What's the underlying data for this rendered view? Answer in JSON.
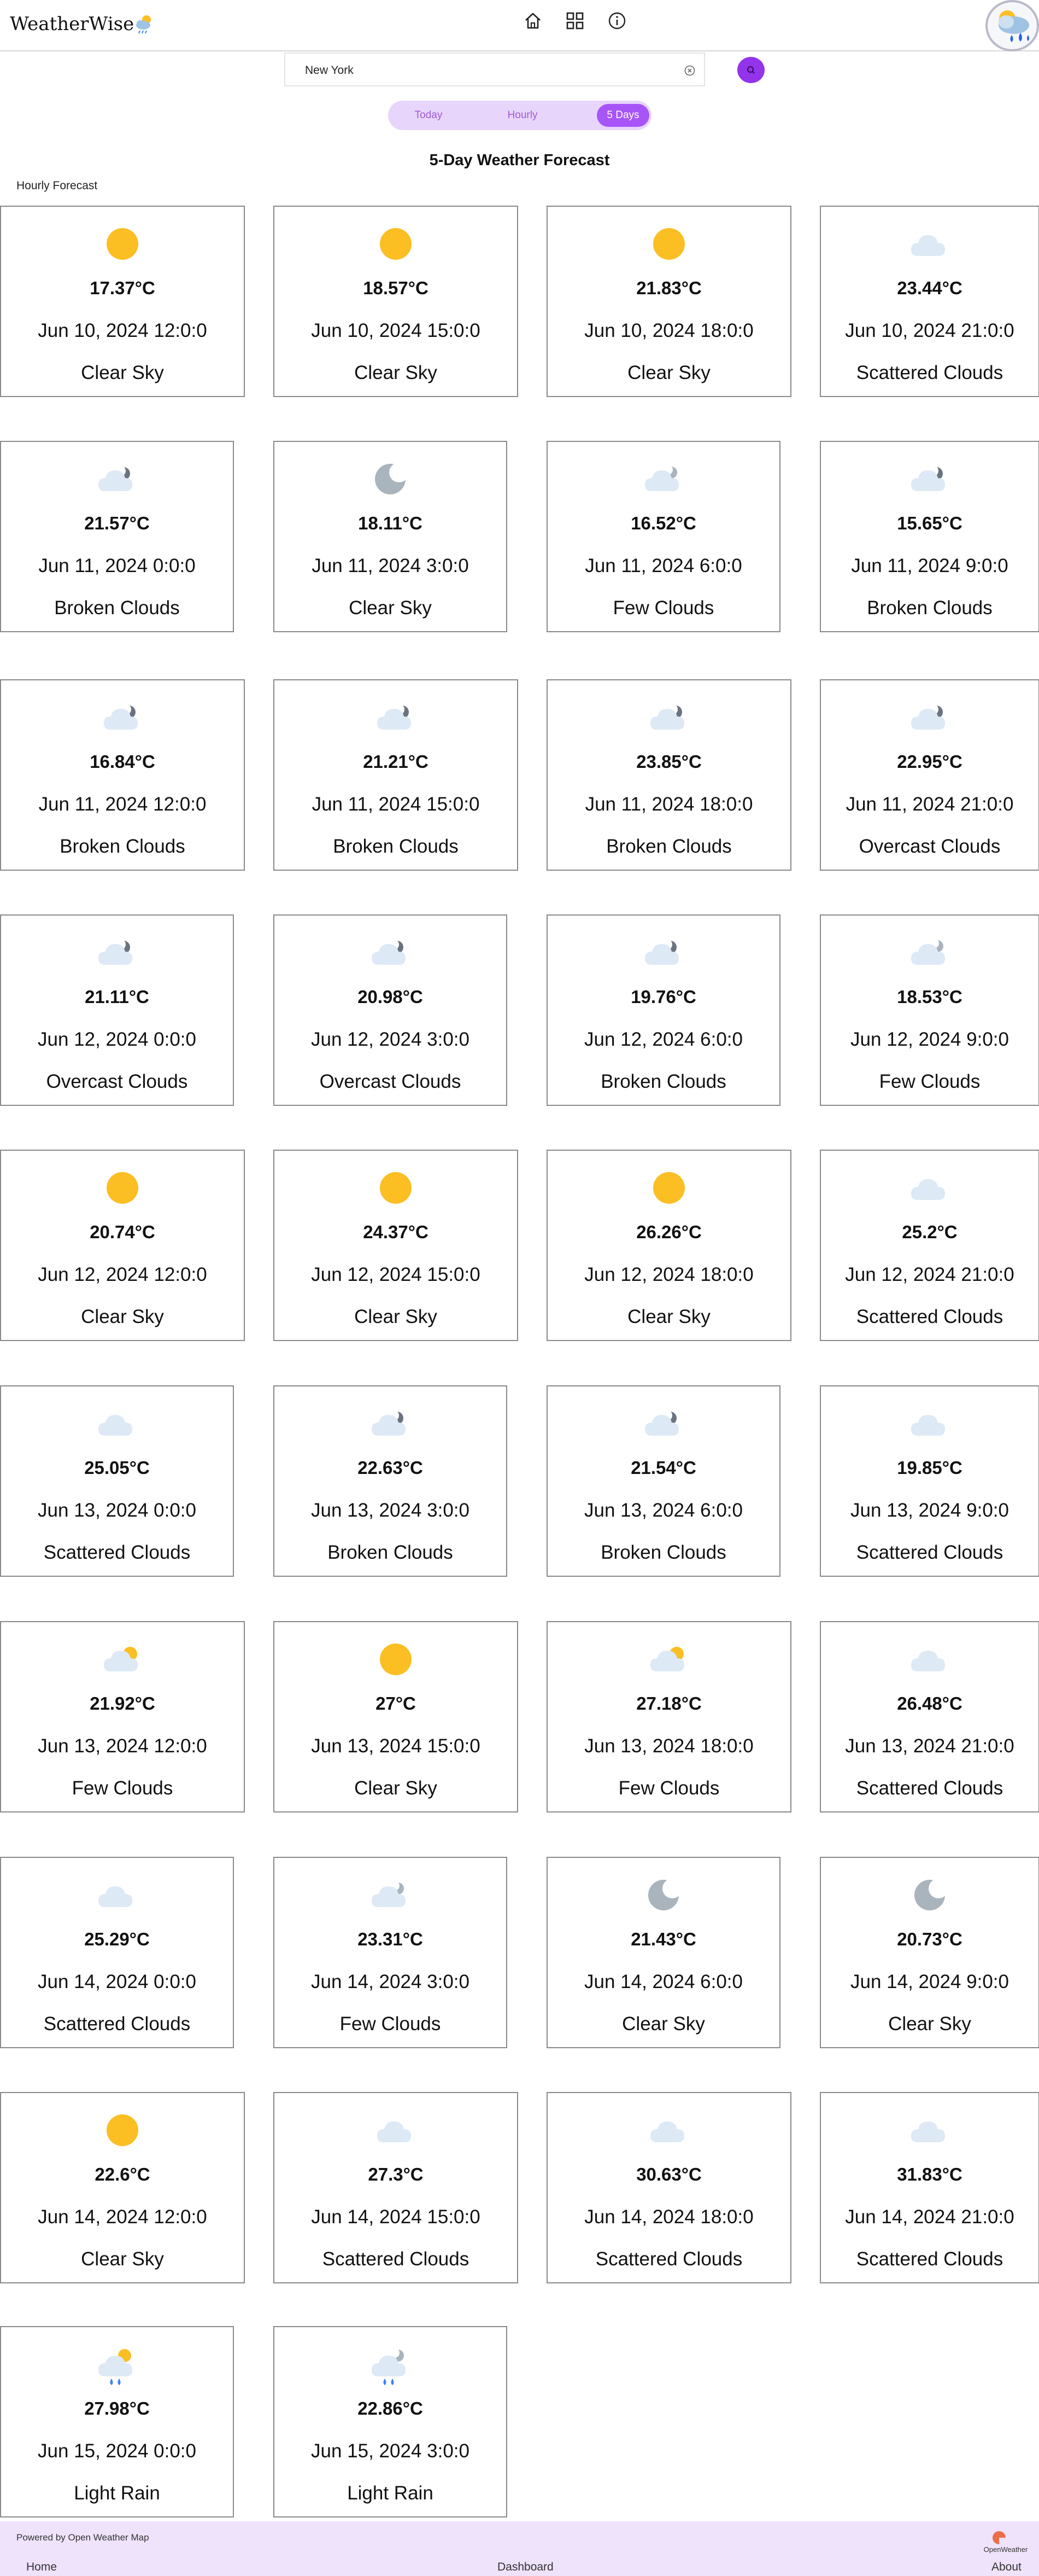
{
  "app": {
    "title": "WeatherWise",
    "nav": {
      "home_icon": "home-icon",
      "dashboard_icon": "grid-icon",
      "about_icon": "info-icon"
    }
  },
  "search": {
    "value": "New York",
    "placeholder": ""
  },
  "tabs": [
    {
      "label": "Today",
      "active": false
    },
    {
      "label": "Hourly",
      "active": false
    },
    {
      "label": "5 Days",
      "active": true
    }
  ],
  "page_title": "5-Day Weather Forecast",
  "section_label": "Hourly Forecast",
  "colors": {
    "accent": "#a855f7",
    "search_button": "#9333ea",
    "tab_bg": "#e8d5fb",
    "footer_bg": "#efe3fc",
    "sun": "#fbbf24",
    "moon": "#a9b4bd",
    "cloud": "#dde9f5"
  },
  "forecast": [
    {
      "temp": "17.37°C",
      "date": "Jun 10, 2024 12:0:0",
      "desc": "Clear Sky",
      "icon": "sun-icon"
    },
    {
      "temp": "18.57°C",
      "date": "Jun 10, 2024 15:0:0",
      "desc": "Clear Sky",
      "icon": "sun-icon"
    },
    {
      "temp": "21.83°C",
      "date": "Jun 10, 2024 18:0:0",
      "desc": "Clear Sky",
      "icon": "sun-icon"
    },
    {
      "temp": "23.44°C",
      "date": "Jun 10, 2024 21:0:0",
      "desc": "Scattered Clouds",
      "icon": "cloud-icon"
    },
    {
      "temp": "21.57°C",
      "date": "Jun 11, 2024 0:0:0",
      "desc": "Broken Clouds",
      "icon": "cloud-moon-dark-icon"
    },
    {
      "temp": "18.11°C",
      "date": "Jun 11, 2024 3:0:0",
      "desc": "Clear Sky",
      "icon": "moon-icon"
    },
    {
      "temp": "16.52°C",
      "date": "Jun 11, 2024 6:0:0",
      "desc": "Few Clouds",
      "icon": "cloud-moon-light-icon"
    },
    {
      "temp": "15.65°C",
      "date": "Jun 11, 2024 9:0:0",
      "desc": "Broken Clouds",
      "icon": "cloud-moon-dark-icon"
    },
    {
      "temp": "16.84°C",
      "date": "Jun 11, 2024 12:0:0",
      "desc": "Broken Clouds",
      "icon": "cloud-moon-dark-icon"
    },
    {
      "temp": "21.21°C",
      "date": "Jun 11, 2024 15:0:0",
      "desc": "Broken Clouds",
      "icon": "cloud-moon-dark-icon"
    },
    {
      "temp": "23.85°C",
      "date": "Jun 11, 2024 18:0:0",
      "desc": "Broken Clouds",
      "icon": "cloud-moon-dark-icon"
    },
    {
      "temp": "22.95°C",
      "date": "Jun 11, 2024 21:0:0",
      "desc": "Overcast Clouds",
      "icon": "cloud-moon-dark-icon"
    },
    {
      "temp": "21.11°C",
      "date": "Jun 12, 2024 0:0:0",
      "desc": "Overcast Clouds",
      "icon": "cloud-moon-dark-icon"
    },
    {
      "temp": "20.98°C",
      "date": "Jun 12, 2024 3:0:0",
      "desc": "Overcast Clouds",
      "icon": "cloud-moon-dark-icon"
    },
    {
      "temp": "19.76°C",
      "date": "Jun 12, 2024 6:0:0",
      "desc": "Broken Clouds",
      "icon": "cloud-moon-dark-icon"
    },
    {
      "temp": "18.53°C",
      "date": "Jun 12, 2024 9:0:0",
      "desc": "Few Clouds",
      "icon": "cloud-moon-light-icon"
    },
    {
      "temp": "20.74°C",
      "date": "Jun 12, 2024 12:0:0",
      "desc": "Clear Sky",
      "icon": "sun-icon"
    },
    {
      "temp": "24.37°C",
      "date": "Jun 12, 2024 15:0:0",
      "desc": "Clear Sky",
      "icon": "sun-icon"
    },
    {
      "temp": "26.26°C",
      "date": "Jun 12, 2024 18:0:0",
      "desc": "Clear Sky",
      "icon": "sun-icon"
    },
    {
      "temp": "25.2°C",
      "date": "Jun 12, 2024 21:0:0",
      "desc": "Scattered Clouds",
      "icon": "cloud-icon"
    },
    {
      "temp": "25.05°C",
      "date": "Jun 13, 2024 0:0:0",
      "desc": "Scattered Clouds",
      "icon": "cloud-icon"
    },
    {
      "temp": "22.63°C",
      "date": "Jun 13, 2024 3:0:0",
      "desc": "Broken Clouds",
      "icon": "cloud-moon-dark-icon"
    },
    {
      "temp": "21.54°C",
      "date": "Jun 13, 2024 6:0:0",
      "desc": "Broken Clouds",
      "icon": "cloud-moon-dark-icon"
    },
    {
      "temp": "19.85°C",
      "date": "Jun 13, 2024 9:0:0",
      "desc": "Scattered Clouds",
      "icon": "cloud-icon"
    },
    {
      "temp": "21.92°C",
      "date": "Jun 13, 2024 12:0:0",
      "desc": "Few Clouds",
      "icon": "cloud-sun-icon"
    },
    {
      "temp": "27°C",
      "date": "Jun 13, 2024 15:0:0",
      "desc": "Clear Sky",
      "icon": "sun-icon"
    },
    {
      "temp": "27.18°C",
      "date": "Jun 13, 2024 18:0:0",
      "desc": "Few Clouds",
      "icon": "cloud-sun-icon"
    },
    {
      "temp": "26.48°C",
      "date": "Jun 13, 2024 21:0:0",
      "desc": "Scattered Clouds",
      "icon": "cloud-icon"
    },
    {
      "temp": "25.29°C",
      "date": "Jun 14, 2024 0:0:0",
      "desc": "Scattered Clouds",
      "icon": "cloud-icon"
    },
    {
      "temp": "23.31°C",
      "date": "Jun 14, 2024 3:0:0",
      "desc": "Few Clouds",
      "icon": "cloud-moon-light-icon"
    },
    {
      "temp": "21.43°C",
      "date": "Jun 14, 2024 6:0:0",
      "desc": "Clear Sky",
      "icon": "moon-icon"
    },
    {
      "temp": "20.73°C",
      "date": "Jun 14, 2024 9:0:0",
      "desc": "Clear Sky",
      "icon": "moon-icon"
    },
    {
      "temp": "22.6°C",
      "date": "Jun 14, 2024 12:0:0",
      "desc": "Clear Sky",
      "icon": "sun-icon"
    },
    {
      "temp": "27.3°C",
      "date": "Jun 14, 2024 15:0:0",
      "desc": "Scattered Clouds",
      "icon": "cloud-icon"
    },
    {
      "temp": "30.63°C",
      "date": "Jun 14, 2024 18:0:0",
      "desc": "Scattered Clouds",
      "icon": "cloud-icon"
    },
    {
      "temp": "31.83°C",
      "date": "Jun 14, 2024 21:0:0",
      "desc": "Scattered Clouds",
      "icon": "cloud-icon"
    },
    {
      "temp": "27.98°C",
      "date": "Jun 15, 2024 0:0:0",
      "desc": "Light Rain",
      "icon": "rain-sun-icon"
    },
    {
      "temp": "22.86°C",
      "date": "Jun 15, 2024 3:0:0",
      "desc": "Light Rain",
      "icon": "rain-moon-icon"
    }
  ],
  "footer": {
    "powered_by": "Powered by Open Weather Map",
    "logo_text": "OpenWeather",
    "links": [
      "Home",
      "Dashboard",
      "About"
    ]
  }
}
